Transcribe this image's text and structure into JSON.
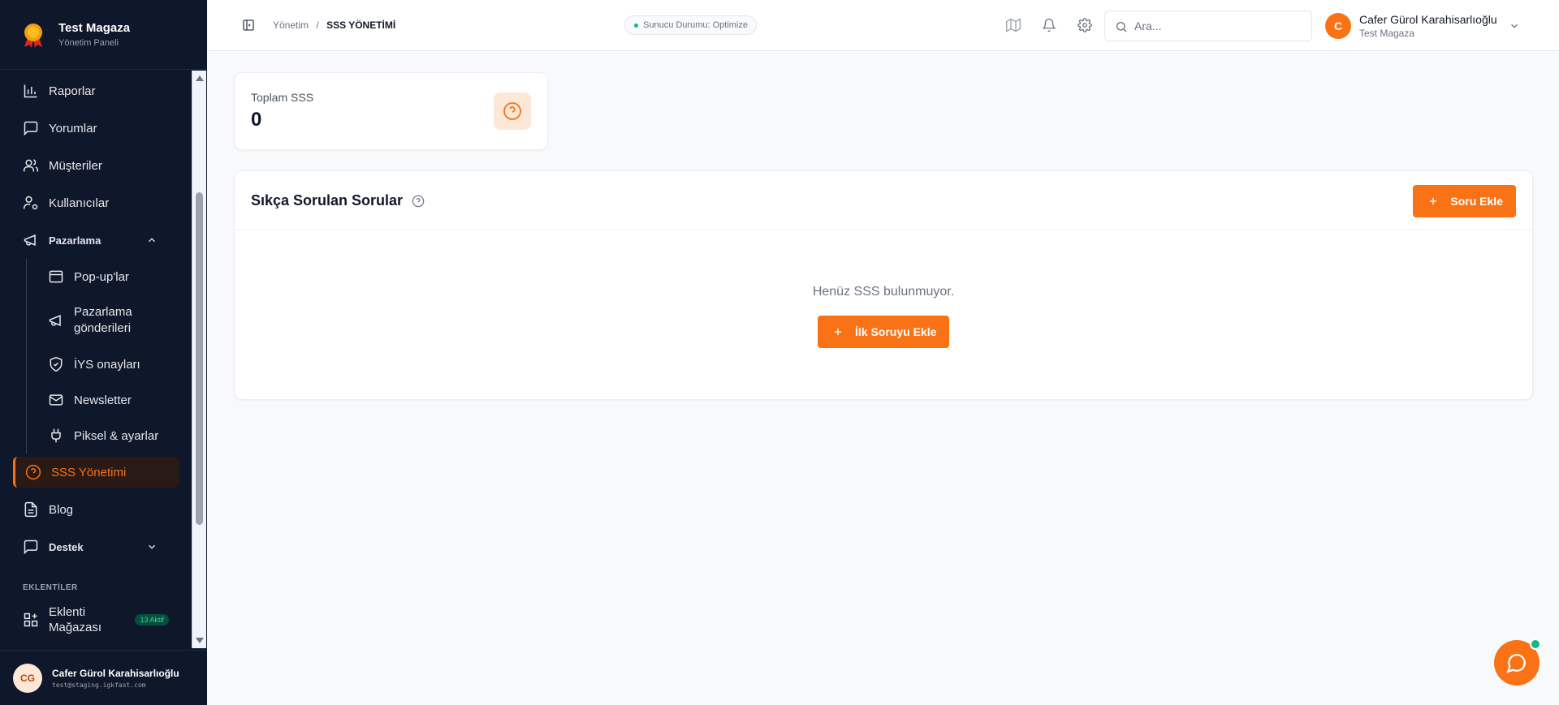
{
  "brand": {
    "title": "Test Magaza",
    "subtitle": "Yönetim Paneli"
  },
  "sidebar": {
    "items": [
      {
        "label": "Raporlar",
        "icon": "bar-chart-icon"
      },
      {
        "label": "Yorumlar",
        "icon": "message-square-icon"
      },
      {
        "label": "Müşteriler",
        "icon": "users-icon"
      },
      {
        "label": "Kullanıcılar",
        "icon": "user-cog-icon"
      }
    ],
    "marketing_group": {
      "label": "Pazarlama",
      "expanded": true,
      "items": [
        {
          "label": "Pop-up'lar",
          "icon": "window-icon"
        },
        {
          "label": "Pazarlama gönderileri",
          "icon": "megaphone-icon"
        },
        {
          "label": "İYS onayları",
          "icon": "shield-check-icon"
        },
        {
          "label": "Newsletter",
          "icon": "mail-icon"
        },
        {
          "label": "Piksel & ayarlar",
          "icon": "plug-icon"
        }
      ]
    },
    "active_item": {
      "label": "SSS Yönetimi",
      "icon": "help-circle-icon"
    },
    "blog": {
      "label": "Blog",
      "icon": "file-text-icon"
    },
    "support_group": {
      "label": "Destek",
      "expanded": false
    },
    "section_label": "EKLENTİLER",
    "plugin_store": {
      "label": "Eklenti Mağazası",
      "badge": "13 Aktif"
    },
    "user": {
      "initials": "CG",
      "name": "Cafer Gürol Karahisarlıoğlu",
      "email": "test@staging.igkfast.com"
    }
  },
  "header": {
    "breadcrumb": {
      "parent": "Yönetim",
      "separator": "/",
      "current": "SSS YÖNETİMİ"
    },
    "server_status": "Sunucu Durumu: Optimize",
    "search_placeholder": "Ara...",
    "user": {
      "initial": "C",
      "name": "Cafer Gürol Karahisarlıoğlu",
      "store": "Test Magaza"
    }
  },
  "stats": {
    "label": "Toplam SSS",
    "value": "0"
  },
  "faq_panel": {
    "title": "Sıkça Sorulan Sorular",
    "add_button": "Soru Ekle",
    "empty_text": "Henüz SSS bulunmuyor.",
    "first_button": "İlk Soruyu Ekle"
  },
  "colors": {
    "accent": "#f97316",
    "sidebar_bg": "#0f172a",
    "status_ok": "#10b981"
  }
}
